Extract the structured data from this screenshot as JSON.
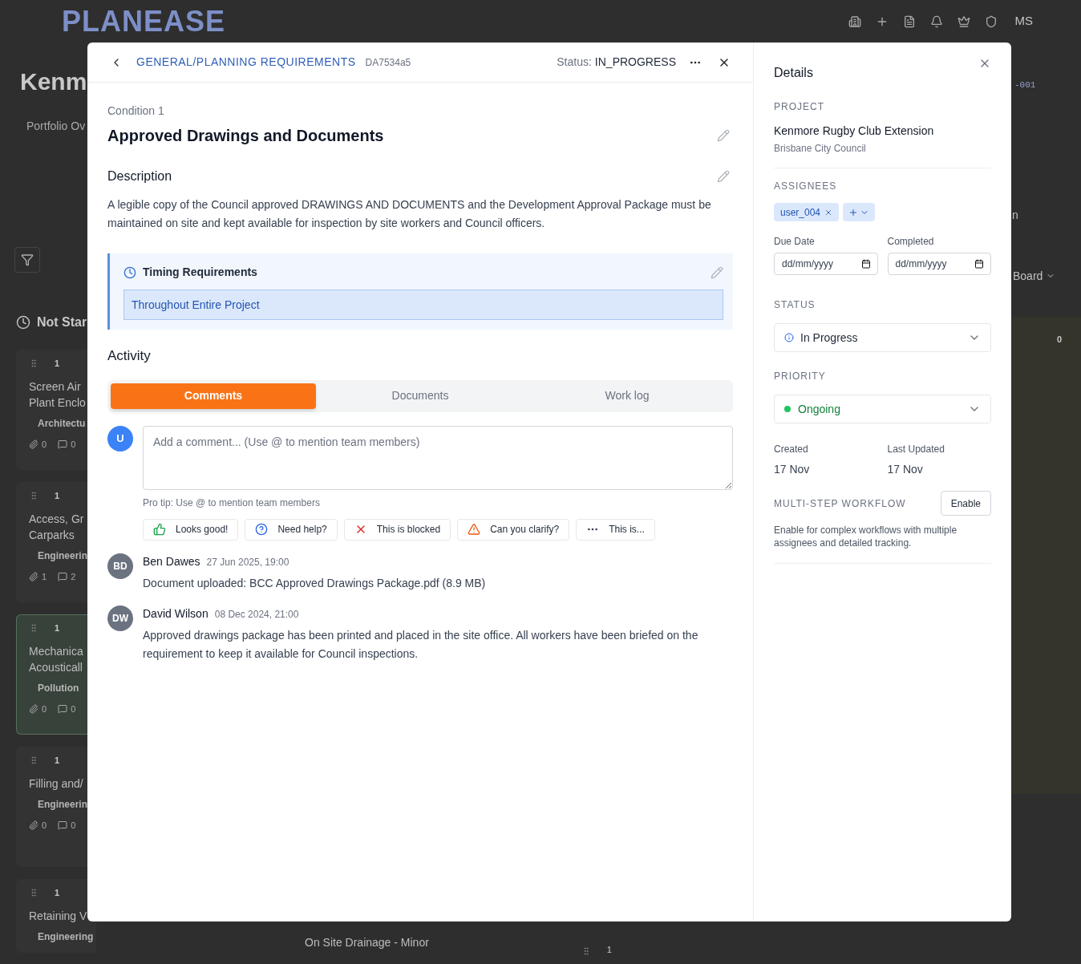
{
  "background": {
    "logo": "PLANEASE",
    "user_initials": "MS",
    "page_title": "Kenm",
    "breadcrumb": "Portfolio Ov",
    "column_title": "Not Star",
    "cards": [
      {
        "count": "1",
        "title_lines": [
          "Screen Air",
          "Plant Enclo"
        ],
        "tag": "Architectu",
        "attachments": "0",
        "comments": "0",
        "selected": false
      },
      {
        "count": "1",
        "title_lines": [
          "Access, Gr",
          "Carparks"
        ],
        "tag": "Engineerin",
        "attachments": "1",
        "comments": "2",
        "selected": false
      },
      {
        "count": "1",
        "title_lines": [
          "Mechanica",
          "Acousticall"
        ],
        "tag": "Pollution",
        "attachments": "0",
        "comments": "0",
        "selected": true
      },
      {
        "count": "1",
        "title_lines": [
          "Filling and/"
        ],
        "tag": "Engineerin",
        "attachments": "0",
        "comments": "0",
        "selected": false
      },
      {
        "count": "1",
        "title_lines": [
          "Retaining V"
        ],
        "tag": "Engineering",
        "selected": false
      }
    ],
    "middle_card_title": "On Site Drainage - Minor",
    "middle_card_count": "1",
    "right_code": "-001",
    "right_fragment": "n",
    "view_select": "Board",
    "right_column_count": "0"
  },
  "modal": {
    "breadcrumb": "GENERAL/PLANNING REQUIREMENTS",
    "code": "DA7534a5",
    "status_label": "Status:",
    "status_value": "IN_PROGRESS",
    "condition_label": "Condition 1",
    "title": "Approved Drawings and Documents",
    "description_heading": "Description",
    "description": "A legible copy of the Council approved DRAWINGS AND DOCUMENTS and the Development Approval Package must be maintained on site and kept available for inspection by site workers and Council officers.",
    "timing": {
      "heading": "Timing Requirements",
      "value": "Throughout Entire Project"
    },
    "activity_heading": "Activity",
    "tabs": [
      {
        "label": "Comments",
        "selected": true
      },
      {
        "label": "Documents",
        "selected": false
      },
      {
        "label": "Work log",
        "selected": false
      }
    ],
    "comment_box": {
      "avatar": "U",
      "placeholder": "Add a comment... (Use @ to mention team members)",
      "tip": "Pro tip: Use @ to mention team members"
    },
    "quick_replies": [
      {
        "kind": "approve",
        "label": "Looks good!"
      },
      {
        "kind": "help",
        "label": "Need help?"
      },
      {
        "kind": "blocked",
        "label": "This is blocked"
      },
      {
        "kind": "clarify",
        "label": "Can you clarify?"
      },
      {
        "kind": "other",
        "label": "This is..."
      }
    ],
    "comments": [
      {
        "initials": "BD",
        "author": "Ben Dawes",
        "time": "27 Jun 2025, 19:00",
        "text": "Document uploaded: BCC Approved Drawings Package.pdf (8.9 MB)"
      },
      {
        "initials": "DW",
        "author": "David Wilson",
        "time": "08 Dec 2024, 21:00",
        "text": "Approved drawings package has been printed and placed in the site office. All workers have been briefed on the requirement to keep it available for Council inspections."
      }
    ]
  },
  "details": {
    "heading": "Details",
    "project_label": "PROJECT",
    "project_name": "Kenmore Rugby Club Extension",
    "council": "Brisbane City Council",
    "assignees_label": "ASSIGNEES",
    "assignees": [
      "user_004"
    ],
    "dates": [
      {
        "label": "Due Date",
        "placeholder": "dd/mm/yyyy"
      },
      {
        "label": "Completed",
        "placeholder": "dd/mm/yyyy"
      }
    ],
    "status_label": "STATUS",
    "status": "In Progress",
    "priority_label": "PRIORITY",
    "priority": "Ongoing",
    "meta": [
      {
        "label": "Created",
        "value": "17 Nov"
      },
      {
        "label": "Last Updated",
        "value": "17 Nov"
      }
    ],
    "workflow_label": "MULTI-STEP WORKFLOW",
    "workflow_button": "Enable",
    "workflow_note": "Enable for complex workflows with multiple assignees and detailed tracking."
  }
}
